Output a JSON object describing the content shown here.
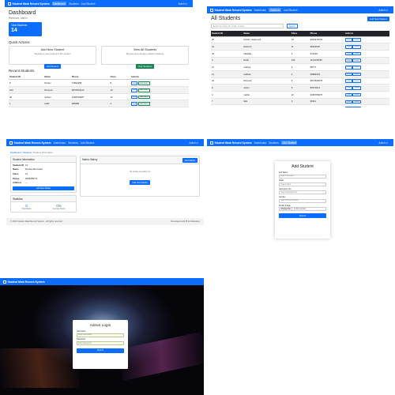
{
  "colors": {
    "primary": "#0d6efd",
    "success": "#198754",
    "dark": "#212529"
  },
  "nav": {
    "brand": "Student Mark Record System",
    "links": [
      "Dashboard",
      "Students",
      "Add Student"
    ],
    "user": "Admin ▾"
  },
  "dashboard": {
    "title": "Dashboard",
    "subtitle": "Welcome, admin",
    "stat_label": "Total Students",
    "stat_value": "14",
    "quick_actions_heading": "Quick Actions",
    "add_card": {
      "title": "Add New Student",
      "desc": "Register a new student in the system",
      "button": "Add Student"
    },
    "view_card": {
      "title": "View All Students",
      "desc": "Browse and manage existing students",
      "button": "View Students"
    },
    "recent_heading": "Recent Students",
    "columns": [
      "Student ID",
      "Name",
      "Phone",
      "Class",
      "Actions"
    ],
    "rows": [
      [
        "8",
        "Rohan",
        "74892358",
        "8"
      ],
      [
        "100",
        "Rumesh",
        "9876543210",
        "10"
      ],
      [
        "50",
        "Sohan",
        "2468790987",
        "10"
      ],
      [
        "1",
        "Hafiz",
        "986988",
        "4"
      ]
    ],
    "view_label": "View",
    "marks_label": "Add Marks"
  },
  "students": {
    "title": "All Students",
    "add_button": "Add New Student",
    "search_placeholder": "Search by name, ID, email, or class...",
    "search_button": "Search",
    "columns": [
      "Student ID",
      "Name",
      "Class",
      "Phone",
      "Actions"
    ],
    "rows": [
      [
        "25",
        "Kshitiz chaturvedi",
        "12",
        "9594378794"
      ],
      [
        "22",
        "Rishesh",
        "11",
        "98353535"
      ],
      [
        "44",
        "hakkilas",
        "3",
        "972228"
      ],
      [
        "5",
        "Radu",
        "103",
        "1112378789"
      ],
      [
        "27",
        "naditya",
        "6",
        "88777"
      ],
      [
        "11",
        "Hafkiss",
        "4",
        "99883333"
      ],
      [
        "24",
        "Ramesh",
        "9",
        "9874563678"
      ],
      [
        "8",
        "Arshu",
        "8",
        "86970013"
      ],
      [
        "4",
        "mahlu",
        "10",
        "3456789075"
      ],
      [
        "7",
        "lalik",
        "3",
        "98111"
      ],
      [
        "3",
        "tagar",
        "4",
        "..."
      ]
    ],
    "view_label": "View",
    "edit_label": "Delete"
  },
  "detail": {
    "crumbs": [
      "Dashboard",
      "Students"
    ],
    "crumb_current": "Student Information",
    "info_heading": "Student Information",
    "fields": [
      {
        "k": "Student ID",
        "v": "13"
      },
      {
        "k": "Name",
        "v": "Roshan Bernstein"
      },
      {
        "k": "Class",
        "v": "12"
      },
      {
        "k": "Phone",
        "v": "9948358771"
      },
      {
        "k": "Address",
        "v": "—"
      }
    ],
    "add_marks_button": "Add New Marks",
    "stats_heading": "Statistics",
    "stat1_value": "0",
    "stat1_label": "Total Marks",
    "stat2_value": "0%",
    "stat2_label": "Average Marks",
    "marks_heading": "Marks History",
    "marks_add": "Add Marks",
    "marks_empty": "No marks recorded yet",
    "marks_first": "Add First Marks",
    "footer_left": "© 2024 Student Mark Record System - All rights reserved",
    "footer_right": "Developed with ❤ for Education"
  },
  "add_form": {
    "title": "Add Student",
    "labels": [
      "Full Name",
      "Class",
      "Admission No",
      "Gender",
      "Profile Image"
    ],
    "placeholders": [
      "Enter Full Name",
      "Select Class",
      "Select Admission No",
      "Select Phone Number"
    ],
    "choose_file": "Choose File",
    "no_file": "no file selected",
    "submit": "Submit"
  },
  "login": {
    "brand": "Student Mark Record System",
    "title": "Admin Login",
    "username_label": "Username",
    "username_placeholder": "Enter Username",
    "password_label": "Password",
    "password_placeholder": "Enter Password",
    "button": "Submit"
  }
}
